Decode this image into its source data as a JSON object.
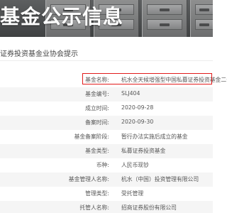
{
  "banner": {
    "title": "基金公示信息"
  },
  "notice": {
    "text": "证券投资基金业协会提示"
  },
  "fund": {
    "rows": [
      {
        "label": "基金名称:",
        "value": "杭水全天候增强型中国私募证券投资基金二号"
      },
      {
        "label": "基金编号:",
        "value": "SLJ404"
      },
      {
        "label": "成立时间:",
        "value": "2020-09-28"
      },
      {
        "label": "备案时间:",
        "value": "2020-09-30"
      },
      {
        "label": "基金备案阶段:",
        "value": "暂行办法实施后成立的基金"
      },
      {
        "label": "基金类型:",
        "value": "私募证券投资基金"
      },
      {
        "label": "币种:",
        "value": "人民币现钞"
      },
      {
        "label": "基金管理人名称:",
        "value": "杭水（中国）投资管理有限公司"
      },
      {
        "label": "管理类型:",
        "value": "受托管理"
      },
      {
        "label": "托管人名称:",
        "value": "招商证券股份有限公司"
      }
    ]
  },
  "colors": {
    "highlight_border": "#e21b1b",
    "banner_bg": "#4f5152"
  }
}
